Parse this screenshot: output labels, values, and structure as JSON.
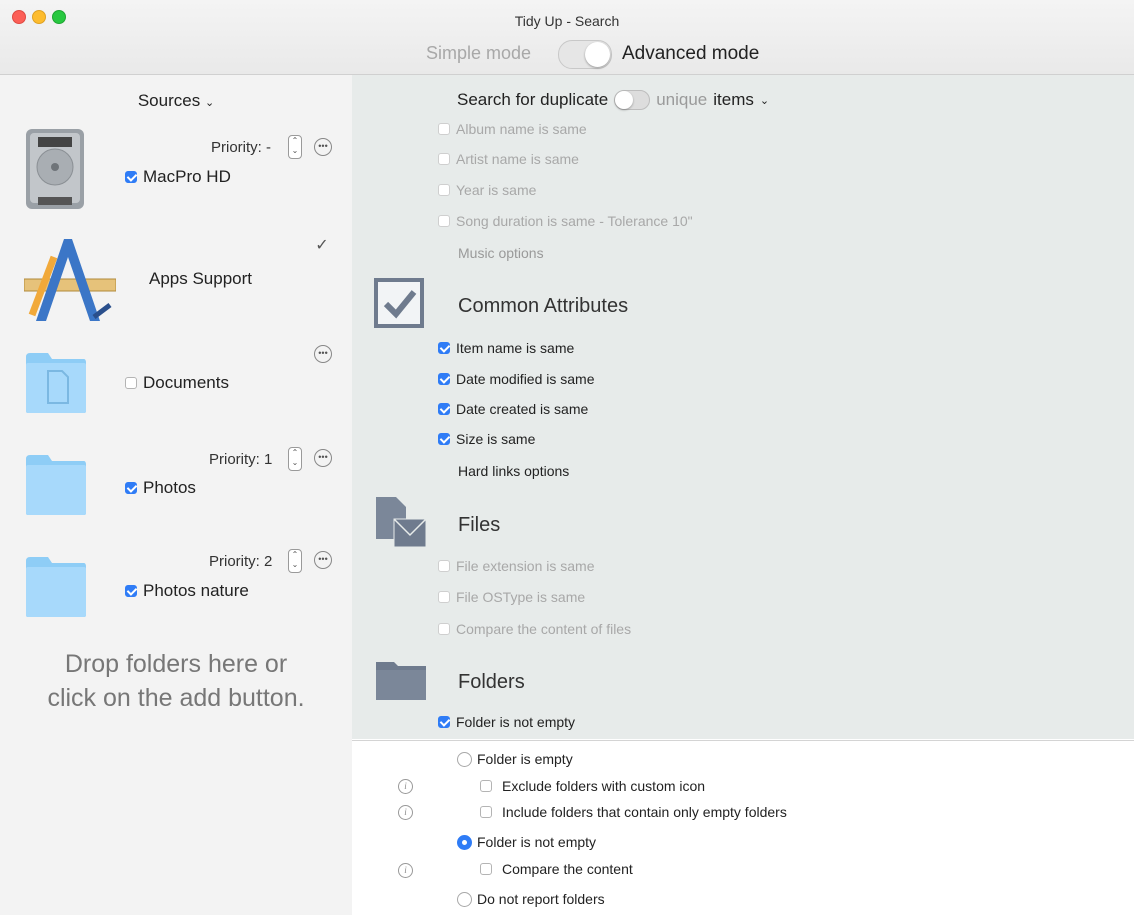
{
  "window": {
    "title": "Tidy Up - Search",
    "mode_simple": "Simple mode",
    "mode_advanced": "Advanced mode",
    "mode_selected": "Advanced mode"
  },
  "sidebar": {
    "header": "Sources",
    "items": [
      {
        "name": "MacPro HD",
        "priority": "Priority: -",
        "checked": true,
        "icon": "hard-drive-icon"
      },
      {
        "name": "Apps Support",
        "priority": "",
        "checked": null,
        "icon": "applications-icon"
      },
      {
        "name": "Documents",
        "priority": "",
        "checked": false,
        "icon": "documents-folder-icon"
      },
      {
        "name": "Photos",
        "priority": "Priority: 1",
        "checked": true,
        "icon": "folder-icon"
      },
      {
        "name": "Photos nature",
        "priority": "Priority: 2",
        "checked": true,
        "icon": "folder-icon"
      }
    ],
    "drop_hint_line1": "Drop folders here or",
    "drop_hint_line2": "click on the add button."
  },
  "search": {
    "prefix": "Search for duplicate",
    "alt": "unique",
    "suffix": "items",
    "music_options": [
      {
        "label": "Album name is same",
        "checked": false
      },
      {
        "label": "Artist name is same",
        "checked": false
      },
      {
        "label": "Year is same",
        "checked": false
      },
      {
        "label": "Song duration is same - Tolerance 10\"",
        "checked": false
      }
    ],
    "music_options_label": "Music options",
    "common": {
      "title": "Common Attributes",
      "items": [
        {
          "label": "Item name is same",
          "checked": true
        },
        {
          "label": "Date modified is same",
          "checked": true
        },
        {
          "label": "Date created is same",
          "checked": true
        },
        {
          "label": "Size is same",
          "checked": true
        }
      ],
      "hard_links_label": "Hard links options"
    },
    "files": {
      "title": "Files",
      "items": [
        {
          "label": "File extension is same",
          "checked": false
        },
        {
          "label": "File OSType is same",
          "checked": false
        },
        {
          "label": "Compare the content of files",
          "checked": false
        }
      ]
    },
    "folders": {
      "title": "Folders",
      "items": [
        {
          "label": "Folder is not empty",
          "checked": true
        }
      ]
    }
  },
  "folder_options": {
    "empty": "Folder is empty",
    "exclude_custom_icon": "Exclude folders with custom icon",
    "include_only_empty": "Include folders that contain only empty folders",
    "not_empty": "Folder is not empty",
    "compare_content": "Compare the content",
    "do_not_report": "Do not report folders",
    "selected": "Folder is not empty"
  },
  "colors": {
    "accent": "#2f7cf6",
    "sidebar_bg": "#f3f3f3",
    "main_bg": "#e7ebea"
  }
}
